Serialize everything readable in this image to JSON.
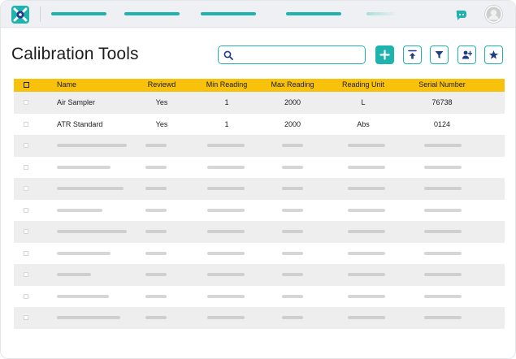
{
  "header": {
    "logo_icon": "logo-gear-icon",
    "brand_color": "#1fb3b0",
    "chat_icon": "chat-bubble-icon",
    "avatar_icon": "user-avatar-icon"
  },
  "page": {
    "title": "Calibration Tools"
  },
  "search": {
    "placeholder": "",
    "value": "",
    "icon": "search-icon"
  },
  "toolbar": {
    "buttons": [
      {
        "name": "add-button",
        "icon": "plus-icon"
      },
      {
        "name": "upload-button",
        "icon": "upload-icon"
      },
      {
        "name": "filter-button",
        "icon": "filter-icon"
      },
      {
        "name": "add-user-button",
        "icon": "user-plus-icon"
      },
      {
        "name": "favorite-button",
        "icon": "star-icon"
      }
    ]
  },
  "table": {
    "header_color": "#f8c20c",
    "columns": [
      "Name",
      "Reviewd",
      "Min Reading",
      "Max Reading",
      "Reading Unit",
      "Serial Number"
    ],
    "rows": [
      {
        "name": "Air Sampler",
        "reviewed": "Yes",
        "min": "1",
        "max": "2000",
        "unit": "L",
        "serial": "76738"
      },
      {
        "name": "ATR Standard",
        "reviewed": "Yes",
        "min": "1",
        "max": "2000",
        "unit": "Abs",
        "serial": "0124"
      }
    ],
    "placeholder_row_count": 9
  }
}
